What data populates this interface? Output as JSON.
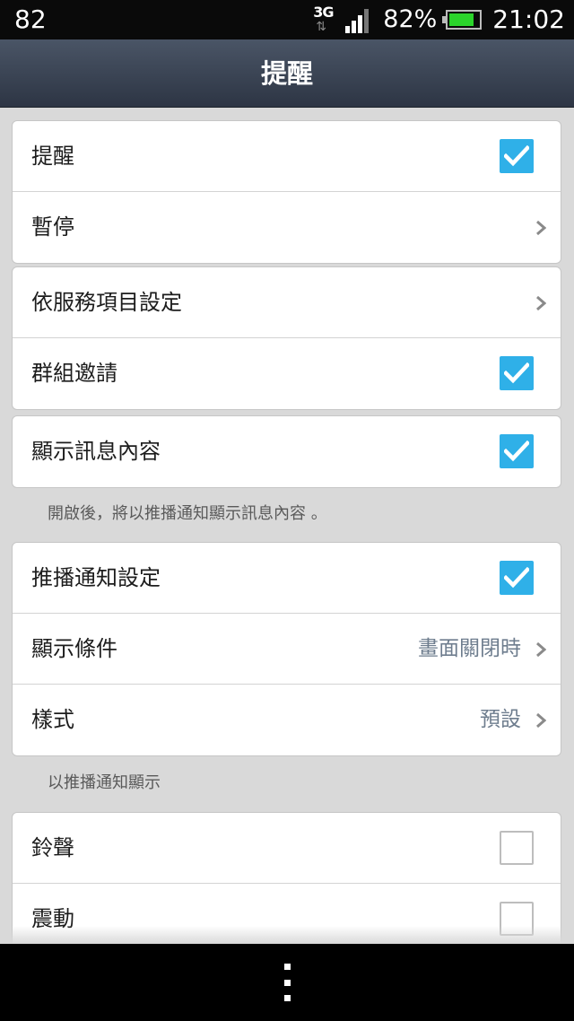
{
  "status_bar": {
    "notification_count": "82",
    "network_type": "3G",
    "battery_percent": "82%",
    "battery_level": 0.82,
    "time": "21:02"
  },
  "header": {
    "title": "提醒"
  },
  "settings": {
    "group1": {
      "notifications": {
        "label": "提醒",
        "checked": true
      },
      "pause": {
        "label": "暫停"
      }
    },
    "group2": {
      "per_service": {
        "label": "依服務項目設定"
      },
      "group_invites": {
        "label": "群組邀請",
        "checked": true
      }
    },
    "group3": {
      "show_message_content": {
        "label": "顯示訊息內容",
        "checked": true
      },
      "note": "開啟後，將以推播通知顯示訊息內容 。"
    },
    "group4": {
      "push_settings": {
        "label": "推播通知設定",
        "checked": true
      },
      "display_condition": {
        "label": "顯示條件",
        "value": "畫面關閉時"
      },
      "style": {
        "label": "樣式",
        "value": "預設"
      },
      "note": "以推播通知顯示"
    },
    "group5": {
      "ringtone": {
        "label": "鈴聲",
        "checked": false
      },
      "vibrate": {
        "label": "震動",
        "checked": false
      }
    }
  },
  "colors": {
    "accent_checkbox": "#2fb0e8",
    "value_text": "#6e7d8e",
    "battery_fill": "#2bd42b"
  }
}
